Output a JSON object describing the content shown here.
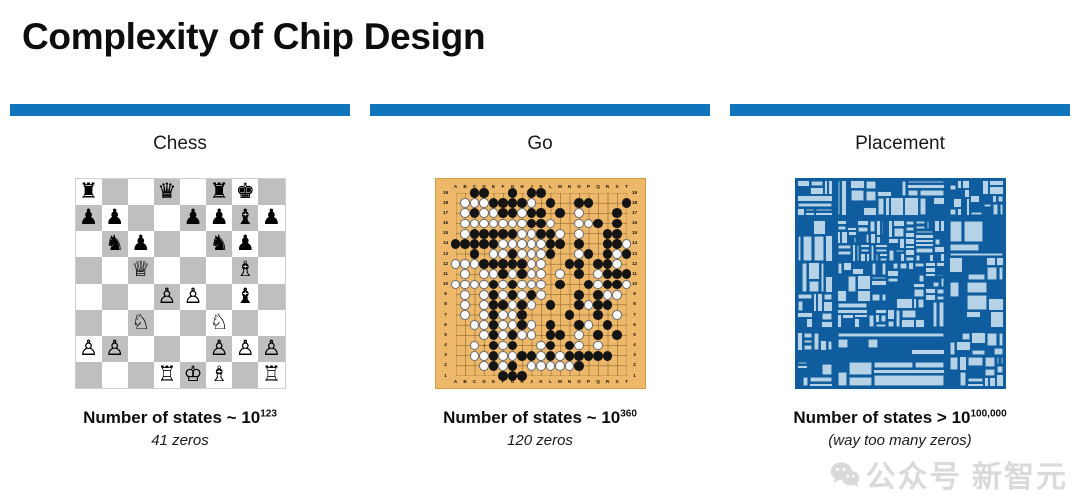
{
  "slide": {
    "title": "Complexity of Chip Design",
    "accent_color": "#1175bb"
  },
  "columns": [
    {
      "id": "chess",
      "heading": "Chess",
      "figure": "chess-board",
      "caption_main_prefix": "Number of states ~ 10",
      "caption_main_exponent": "123",
      "caption_sub": "41 zeros"
    },
    {
      "id": "go",
      "heading": "Go",
      "figure": "go-board",
      "caption_main_prefix": "Number of states ~ 10",
      "caption_main_exponent": "360",
      "caption_sub": "120 zeros"
    },
    {
      "id": "placement",
      "heading": "Placement",
      "figure": "chip-floorplan",
      "caption_main_prefix": "Number of states > 10",
      "caption_main_exponent": "100,000",
      "caption_sub": "(way too many zeros)"
    }
  ],
  "chess_board": {
    "light_color": "#ffffff",
    "dark_color": "#bfbfbf",
    "orientation": "white-bottom",
    "ranks": [
      [
        "r",
        "",
        "",
        "q",
        "",
        "r",
        "k",
        ""
      ],
      [
        "p",
        "p",
        "",
        "",
        "p",
        "p",
        "b",
        "p"
      ],
      [
        "",
        "n",
        "p",
        "",
        "",
        "n",
        "p",
        ""
      ],
      [
        "",
        "",
        "Q",
        "",
        "",
        "",
        "B",
        ""
      ],
      [
        "",
        "",
        "",
        "P",
        "P",
        "",
        "b",
        ""
      ],
      [
        "",
        "",
        "N",
        "",
        "",
        "N",
        "",
        ""
      ],
      [
        "P",
        "P",
        "",
        "",
        "",
        "P",
        "P",
        "P"
      ],
      [
        "",
        "",
        "",
        "R",
        "K",
        "B",
        "",
        "R"
      ]
    ],
    "glyphs": {
      "K": "♔",
      "Q": "♕",
      "R": "♖",
      "B": "♗",
      "N": "♘",
      "P": "♙",
      "k": "♚",
      "q": "♛",
      "r": "♜",
      "b": "♝",
      "n": "♞",
      "p": "♟"
    }
  },
  "go_board": {
    "size": 19,
    "board_color": "#edb86a",
    "line_color": "#7b5a22",
    "column_labels": [
      "A",
      "B",
      "C",
      "D",
      "E",
      "F",
      "G",
      "H",
      "J",
      "K",
      "L",
      "M",
      "N",
      "O",
      "P",
      "Q",
      "R",
      "S",
      "T"
    ],
    "row_labels": [
      "19",
      "18",
      "17",
      "16",
      "15",
      "14",
      "13",
      "12",
      "11",
      "10",
      "9",
      "8",
      "7",
      "6",
      "5",
      "4",
      "3",
      "2",
      "1"
    ],
    "black_color": "#141414",
    "white_color": "#fbfbfb",
    "rows_top_to_bottom": [
      "..BB..B.BB.........",
      ".WWWBBBBW.B..BB...B",
      ".WBWWBBWBB.B.W...B.",
      ".WWWWWWWBBW..WWB.B.",
      ".WBBBBBWWBBW.W..BB.",
      "BBBBBWWWWWBB.B..BBW",
      "..B.WWBWWWB..WB.BWB",
      "WWWBBBBBWW..BB.BBW.",
      ".W.WWBWBWW.W.B.WBBB",
      "WWWWBWBWWW.B..BWBBW",
      ".W.WBWBWBW...B.BWW.",
      ".W.WBBWBW.B..BWBB..",
      ".W.WBWWB....B..B.W.",
      "..WWBWWBW.B..BW.B..",
      "...WBWBWW.BB.W.B.B.",
      "..W.BWB..WB.BW.W...",
      "..WWBWWBBWBWBBBBB..",
      "...WBWB.WWWWWB.....",
      ".....BBB..........."
    ]
  },
  "placement_figure": {
    "background_color": "#0f5d9e",
    "block_color": "#b6d2e6",
    "block_border_color": "#0f5d9e",
    "description": "chip floorplan macro placement"
  },
  "watermark": {
    "text": "公众号 新智元",
    "logo": "wechat-icon"
  }
}
